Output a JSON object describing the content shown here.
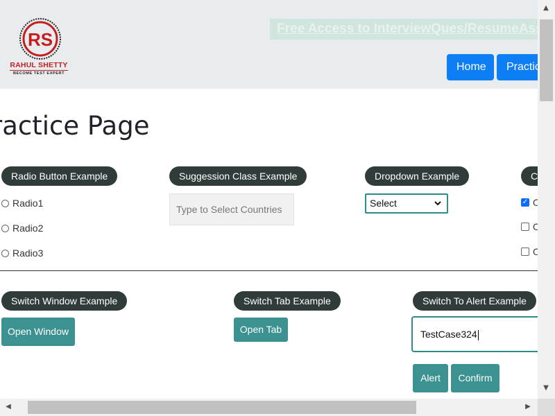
{
  "header": {
    "logo": {
      "name": "RAHUL SHETTY",
      "tagline": "BECOME TEST EXPERT"
    },
    "promo_link": "Free Access to InterviewQues/ResumeAssistance/Material",
    "nav": {
      "home": "Home",
      "practice": "Practice"
    }
  },
  "page_title": "ractice Page",
  "radio_section": {
    "title": "Radio Button Example",
    "options": [
      "Radio1",
      "Radio2",
      "Radio3"
    ]
  },
  "suggestion_section": {
    "title": "Suggession Class Example",
    "placeholder": "Type to Select Countries"
  },
  "dropdown_section": {
    "title": "Dropdown Example",
    "selected": "Select"
  },
  "checkbox_section": {
    "title": "C",
    "options": [
      {
        "label": "O",
        "checked": true
      },
      {
        "label": "O",
        "checked": false
      },
      {
        "label": "O",
        "checked": false
      }
    ]
  },
  "switch_window": {
    "title": "Switch Window Example",
    "button": "Open Window"
  },
  "switch_tab": {
    "title": "Switch Tab Example",
    "button": "Open Tab"
  },
  "alert_section": {
    "title": "Switch To Alert Example",
    "input_value": "TestCase324",
    "alert_button": "Alert",
    "confirm_button": "Confirm"
  },
  "colors": {
    "teal": "#3c9191",
    "pill": "#2f3c3a",
    "nav_blue": "#0d7ef5",
    "brand_red": "#c41e1e"
  }
}
